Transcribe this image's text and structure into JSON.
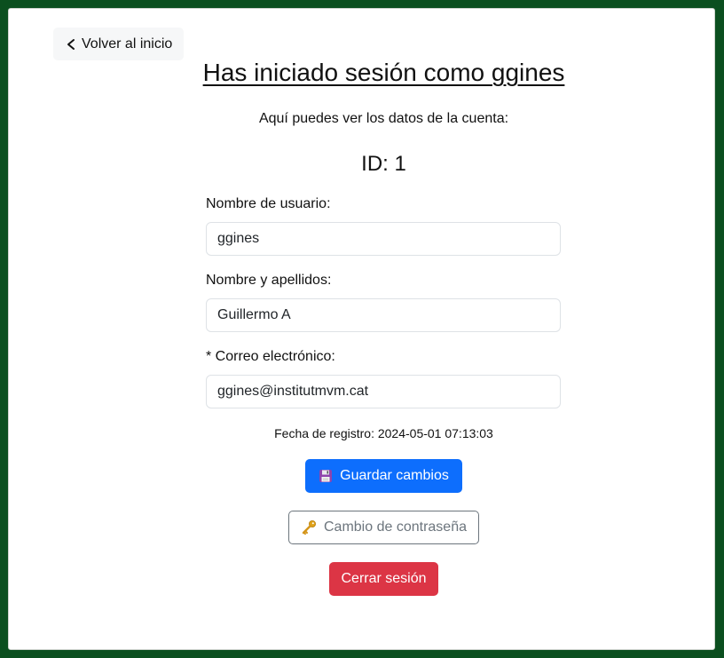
{
  "nav": {
    "back_label": "Volver al inicio",
    "back_icon": "chevron-left-icon"
  },
  "header": {
    "title": "Has iniciado sesión como ggines",
    "subtitle": "Aquí puedes ver los datos de la cuenta:",
    "id_text": "ID: 1"
  },
  "form": {
    "username": {
      "label": "Nombre de usuario:",
      "value": "ggines"
    },
    "fullname": {
      "label": "Nombre y apellidos:",
      "value": "Guillermo A"
    },
    "email": {
      "label": "* Correo electrónico:",
      "value": "ggines@institutmvm.cat"
    },
    "registration_date": "Fecha de registro: 2024-05-01 07:13:03"
  },
  "actions": {
    "save_label": "Guardar cambios",
    "save_icon": "floppy-disk-icon",
    "password_label": "Cambio de contraseña",
    "password_icon": "key-icon",
    "logout_label": "Cerrar sesión"
  },
  "colors": {
    "background": "#0b4f1f",
    "primary": "#0d6efd",
    "secondary": "#6c757d",
    "danger": "#dc3545"
  }
}
